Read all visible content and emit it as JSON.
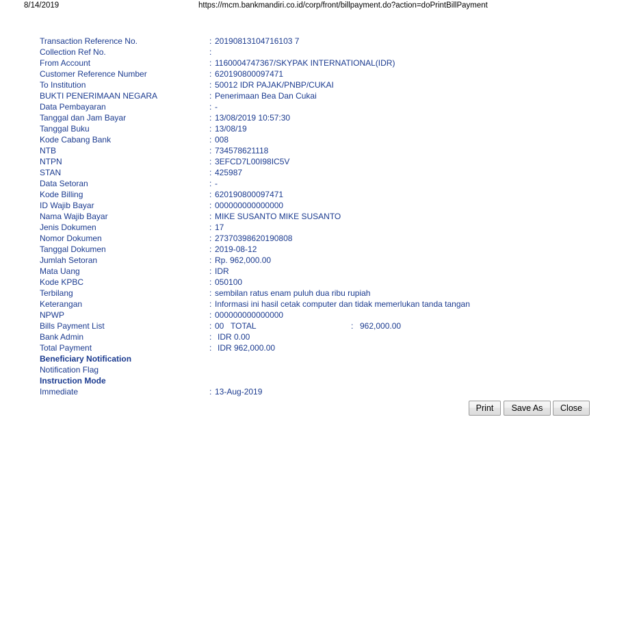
{
  "print_header": {
    "date": "8/14/2019",
    "url": "https://mcm.bankmandiri.co.id/corp/front/billpayment.do?action=doPrintBillPayment"
  },
  "theme": {
    "text_color": "#1a3a8f",
    "header_color": "#000000",
    "button_text_color": "#000000",
    "button_border_color": "#9a9a9a",
    "background": "#ffffff"
  },
  "receipt": {
    "rows": [
      {
        "label": "Transaction Reference No.",
        "colon": ":",
        "value": "20190813104716103 7"
      },
      {
        "label": "Collection Ref No.",
        "colon": ":",
        "value": ""
      },
      {
        "label": "From Account",
        "colon": ":",
        "value": "1160004747367/SKYPAK INTERNATIONAL(IDR)"
      },
      {
        "label": "Customer Reference Number",
        "colon": ":",
        "value": "620190800097471"
      },
      {
        "label": "To Institution",
        "colon": ":",
        "value": "50012 IDR PAJAK/PNBP/CUKAI"
      },
      {
        "label": "BUKTI PENERIMAAN NEGARA",
        "colon": ":",
        "value": "Penerimaan Bea Dan Cukai"
      },
      {
        "label": "Data Pembayaran",
        "colon": ":",
        "value": "-"
      },
      {
        "label": "Tanggal dan Jam Bayar",
        "colon": ":",
        "value": "13/08/2019 10:57:30"
      },
      {
        "label": "Tanggal Buku",
        "colon": ":",
        "value": "13/08/19"
      },
      {
        "label": "Kode Cabang Bank",
        "colon": ":",
        "value": "008"
      },
      {
        "label": "NTB",
        "colon": ":",
        "value": "734578621118"
      },
      {
        "label": "NTPN",
        "colon": ":",
        "value": "3EFCD7L00I98IC5V"
      },
      {
        "label": "STAN",
        "colon": ":",
        "value": "425987"
      },
      {
        "label": "Data Setoran",
        "colon": ":",
        "value": "-"
      },
      {
        "label": "Kode Billing",
        "colon": ":",
        "value": "620190800097471"
      },
      {
        "label": "ID Wajib Bayar",
        "colon": ":",
        "value": "000000000000000"
      },
      {
        "label": "Nama Wajib Bayar",
        "colon": ":",
        "value": "MIKE SUSANTO MIKE SUSANTO"
      },
      {
        "label": "Jenis Dokumen",
        "colon": ":",
        "value": "17"
      },
      {
        "label": "Nomor Dokumen",
        "colon": ":",
        "value": "27370398620190808"
      },
      {
        "label": "Tanggal Dokumen",
        "colon": ":",
        "value": "2019-08-12"
      },
      {
        "label": "Jumlah Setoran",
        "colon": ":",
        "value": "Rp. 962,000.00"
      },
      {
        "label": "Mata Uang",
        "colon": ":",
        "value": "IDR"
      },
      {
        "label": "Kode KPBC",
        "colon": ":",
        "value": "050100"
      },
      {
        "label": "Terbilang",
        "colon": ":",
        "value": "sembilan ratus enam puluh dua ribu rupiah"
      },
      {
        "label": "Keterangan",
        "colon": ":",
        "value": "Informasi ini hasil cetak computer dan tidak memerlukan tanda tangan"
      },
      {
        "label": "NPWP",
        "colon": ":",
        "value": "000000000000000"
      }
    ],
    "bills_payment_list": {
      "label": "Bills Payment List",
      "colon": ":",
      "code": "00",
      "total_label": "TOTAL",
      "colon2": ":",
      "total_amount": "962,000.00"
    },
    "bank_admin": {
      "label": "Bank Admin",
      "colon": ":",
      "value": "IDR 0.00"
    },
    "total_payment": {
      "label": "Total Payment",
      "colon": ":",
      "value": "IDR 962,000.00"
    },
    "beneficiary_notification": {
      "label": "Beneficiary Notification"
    },
    "notification_flag": {
      "label": "Notification Flag"
    },
    "instruction_mode": {
      "label": "Instruction Mode"
    },
    "immediate": {
      "label": "Immediate",
      "colon": ":",
      "value": "13-Aug-2019"
    }
  },
  "buttons": {
    "print": "Print",
    "save_as": "Save As",
    "close": "Close"
  }
}
